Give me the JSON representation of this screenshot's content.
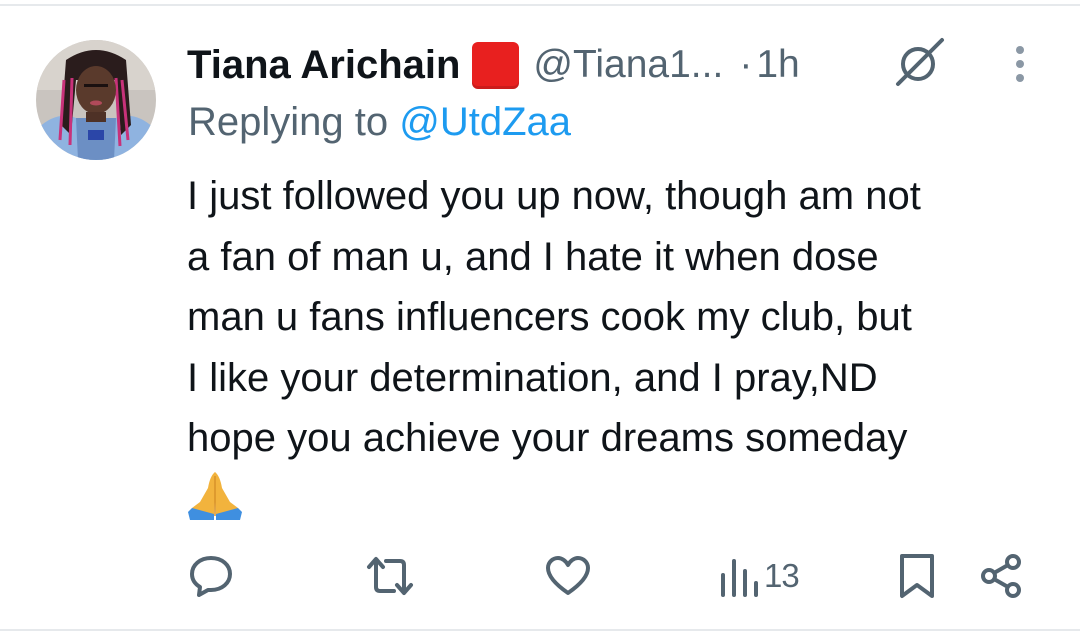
{
  "tweet": {
    "author_name": "Tiana Arichain",
    "author_handle": "@Tiana1...",
    "separator": "·",
    "timestamp": "1h",
    "reply_prefix": "Replying to",
    "reply_to": "@UtdZaa",
    "body_lines": [
      "I just followed you up now, though am not",
      "a fan of man u, and I hate it when dose",
      "man u fans influencers cook my club, but",
      "I like your determination, and I pray,ND",
      "hope you achieve your dreams someday"
    ],
    "emoji": "folded-hands-icon",
    "flag_badge": "red-square"
  },
  "actions": {
    "reply_icon": "comment-icon",
    "retweet_icon": "retweet-icon",
    "like_icon": "heart-icon",
    "views_icon": "views-bar-chart-icon",
    "views_count": "13",
    "bookmark_icon": "bookmark-icon",
    "share_icon": "share-icon"
  },
  "colors": {
    "text": "#0f1419",
    "secondary": "#536471",
    "link": "#1d9bf0",
    "flag": "#e8201f",
    "divider": "#e6e9ec"
  }
}
